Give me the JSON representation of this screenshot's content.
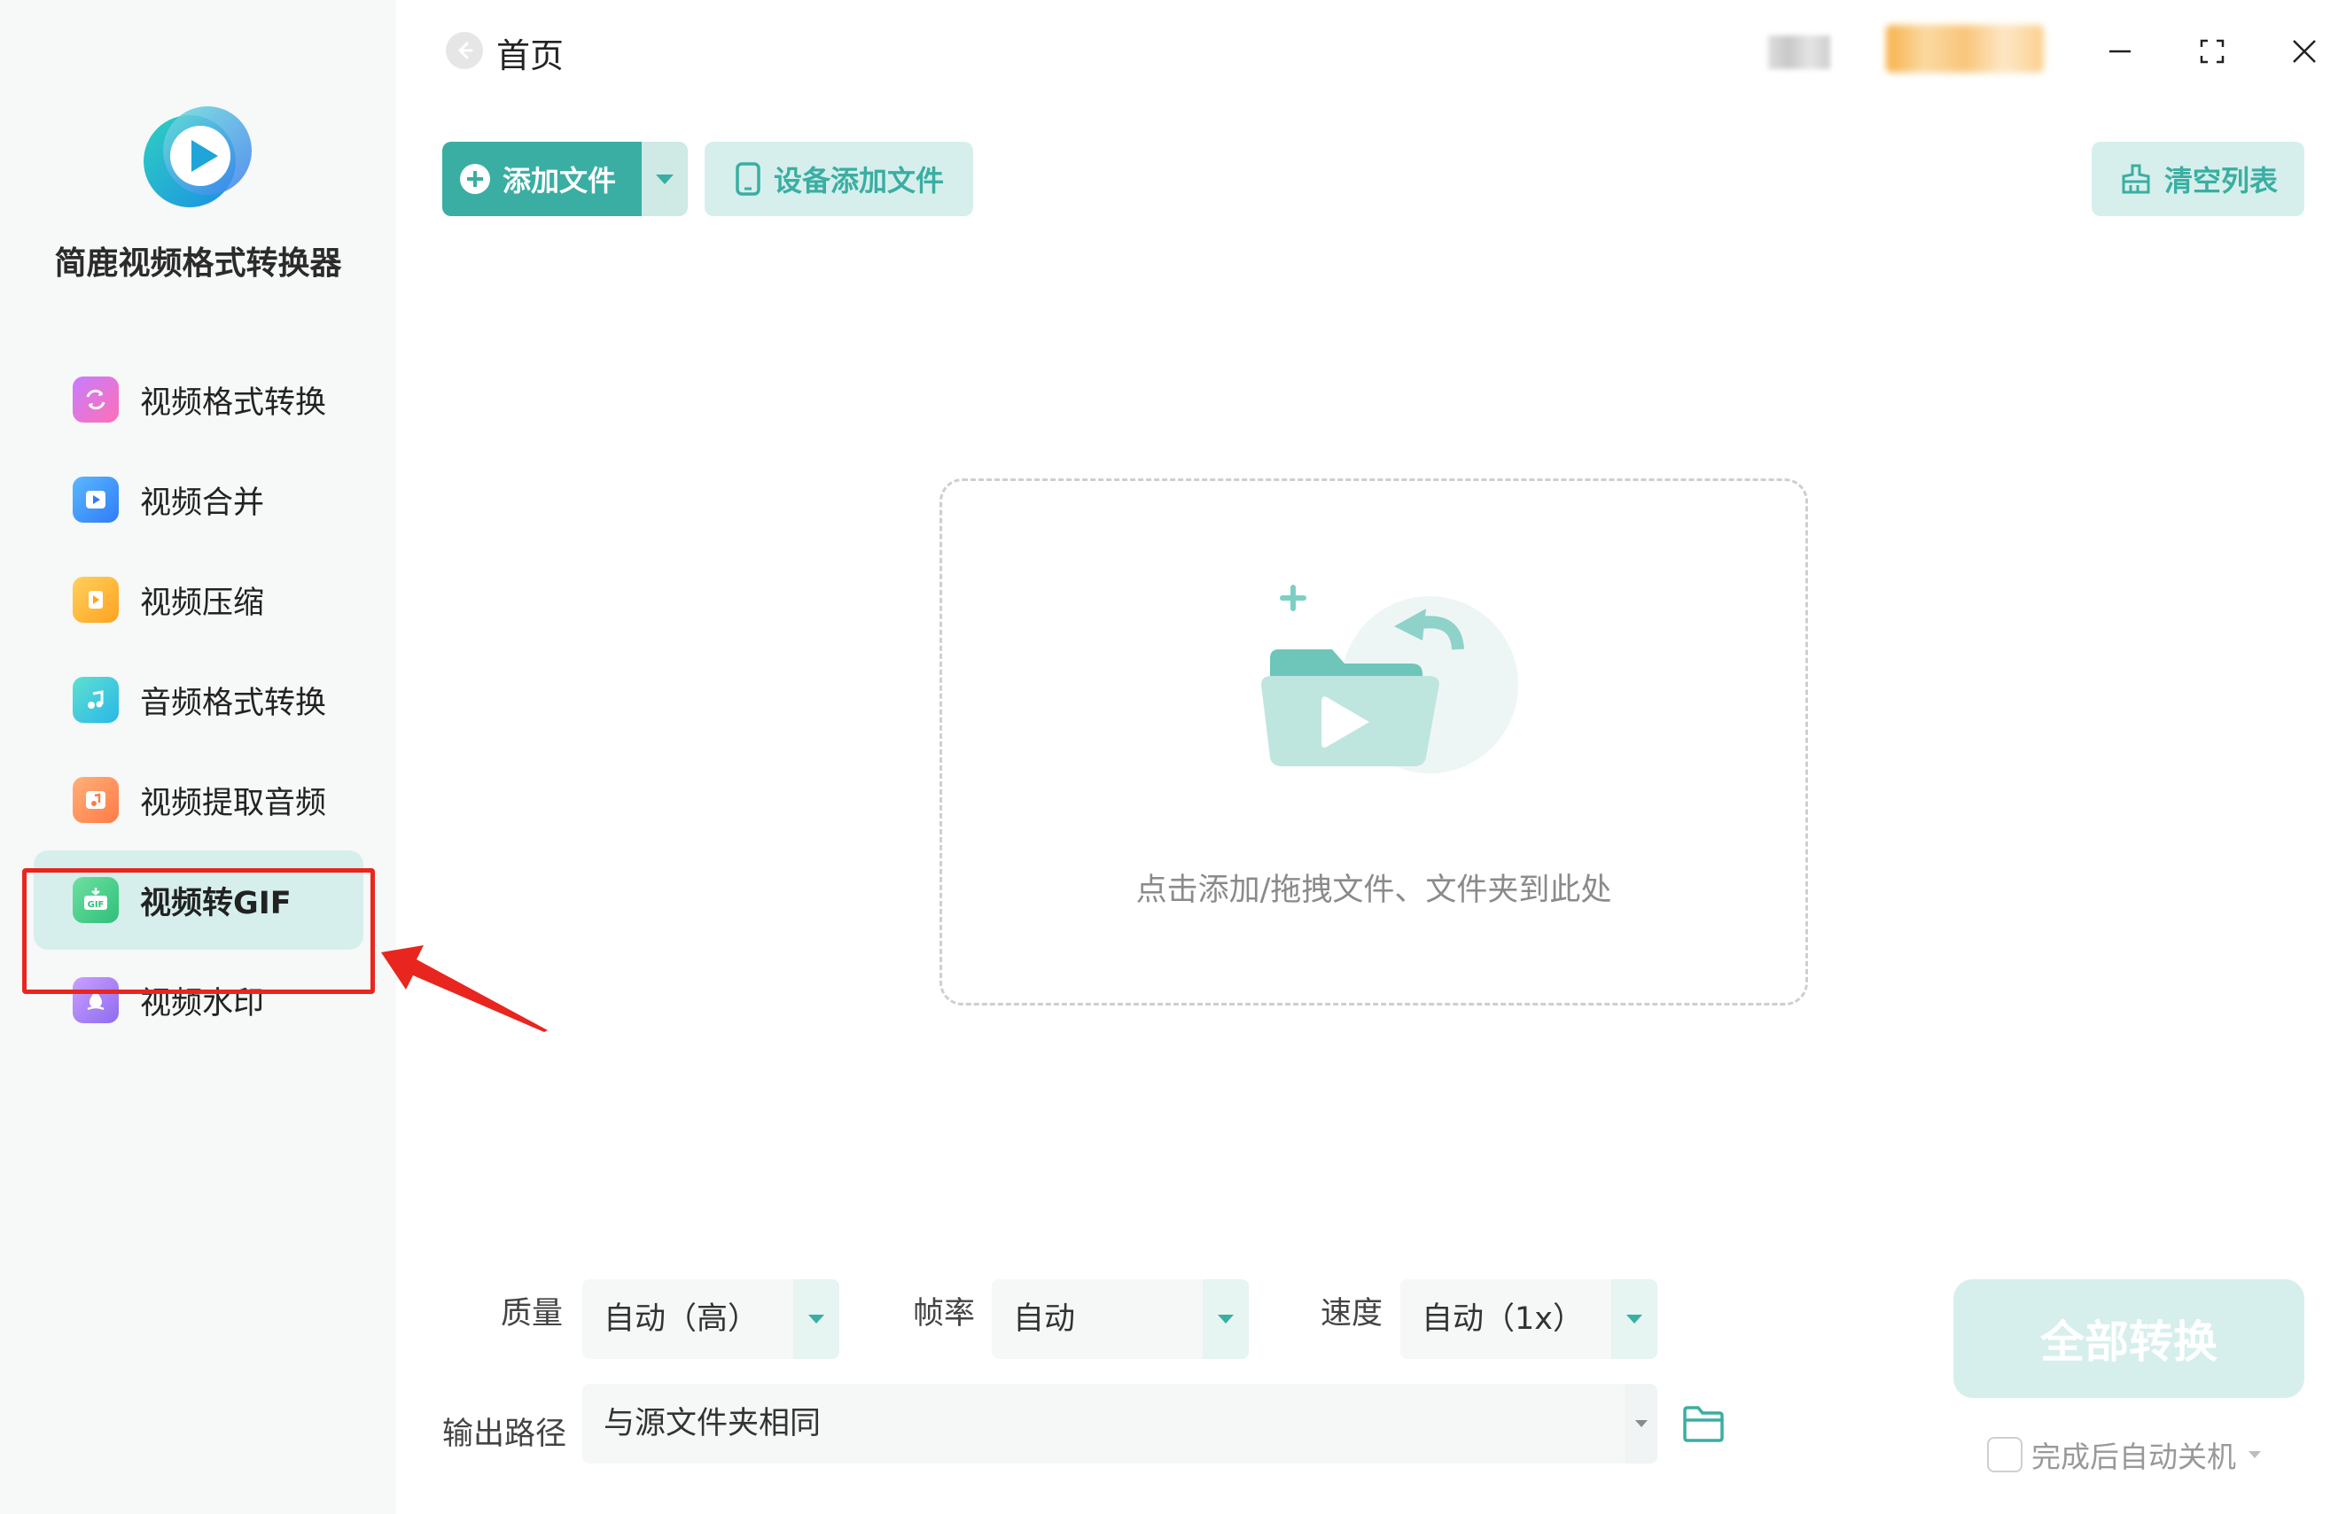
{
  "app": {
    "name": "简鹿视频格式转换器"
  },
  "sidebar": {
    "items": [
      {
        "label": "视频格式转换",
        "icon": "video-convert-icon",
        "active": false
      },
      {
        "label": "视频合并",
        "icon": "video-merge-icon",
        "active": false
      },
      {
        "label": "视频压缩",
        "icon": "video-compress-icon",
        "active": false
      },
      {
        "label": "音频格式转换",
        "icon": "audio-convert-icon",
        "active": false
      },
      {
        "label": "视频提取音频",
        "icon": "extract-audio-icon",
        "active": false
      },
      {
        "label": "视频转GIF",
        "icon": "video-to-gif-icon",
        "active": true
      },
      {
        "label": "视频水印",
        "icon": "video-watermark-icon",
        "active": false
      }
    ]
  },
  "header": {
    "title": "首页"
  },
  "toolbar": {
    "add_file_label": "添加文件",
    "device_add_label": "设备添加文件",
    "clear_list_label": "清空列表"
  },
  "dropzone": {
    "hint": "点击添加/拖拽文件、文件夹到此处"
  },
  "settings": {
    "quality": {
      "label": "质量",
      "value": "自动（高）"
    },
    "framerate": {
      "label": "帧率",
      "value": "自动"
    },
    "speed": {
      "label": "速度",
      "value": "自动（1x）"
    },
    "output": {
      "label": "输出路径",
      "value": "与源文件夹相同"
    }
  },
  "actions": {
    "convert_all_label": "全部转换",
    "shutdown_label": "完成后自动关机"
  },
  "colors": {
    "accent": "#3aaea2",
    "accent_light": "#d6efec",
    "highlight": "#e8261f"
  }
}
